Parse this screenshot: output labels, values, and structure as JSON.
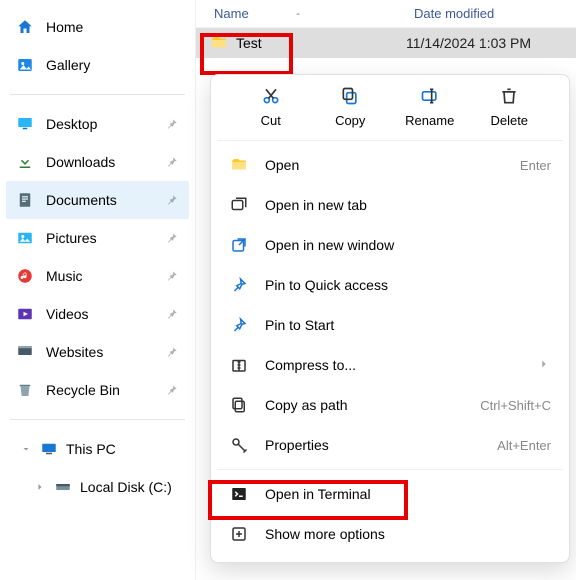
{
  "sidebar": {
    "top": [
      {
        "label": "Home",
        "ic": "home"
      },
      {
        "label": "Gallery",
        "ic": "gallery"
      }
    ],
    "quick": [
      {
        "label": "Desktop",
        "ic": "desktop"
      },
      {
        "label": "Downloads",
        "ic": "download"
      },
      {
        "label": "Documents",
        "ic": "doc",
        "active": true
      },
      {
        "label": "Pictures",
        "ic": "pic"
      },
      {
        "label": "Music",
        "ic": "music"
      },
      {
        "label": "Videos",
        "ic": "video"
      },
      {
        "label": "Websites",
        "ic": "site"
      },
      {
        "label": "Recycle Bin",
        "ic": "bin"
      }
    ],
    "tree": {
      "root": "This PC",
      "child": "Local Disk (C:)"
    }
  },
  "columns": {
    "name": "Name",
    "date": "Date modified"
  },
  "row": {
    "name": "Test",
    "date": "11/14/2024 1:03 PM"
  },
  "toolbar": {
    "cut": "Cut",
    "copy": "Copy",
    "rename": "Rename",
    "delete": "Delete"
  },
  "menu": {
    "open": "Open",
    "open_hint": "Enter",
    "newtab": "Open in new tab",
    "newwin": "Open in new window",
    "pinquick": "Pin to Quick access",
    "pinstart": "Pin to Start",
    "compress": "Compress to...",
    "copypath": "Copy as path",
    "copypath_hint": "Ctrl+Shift+C",
    "properties": "Properties",
    "properties_hint": "Alt+Enter",
    "terminal": "Open in Terminal",
    "more": "Show more options"
  }
}
